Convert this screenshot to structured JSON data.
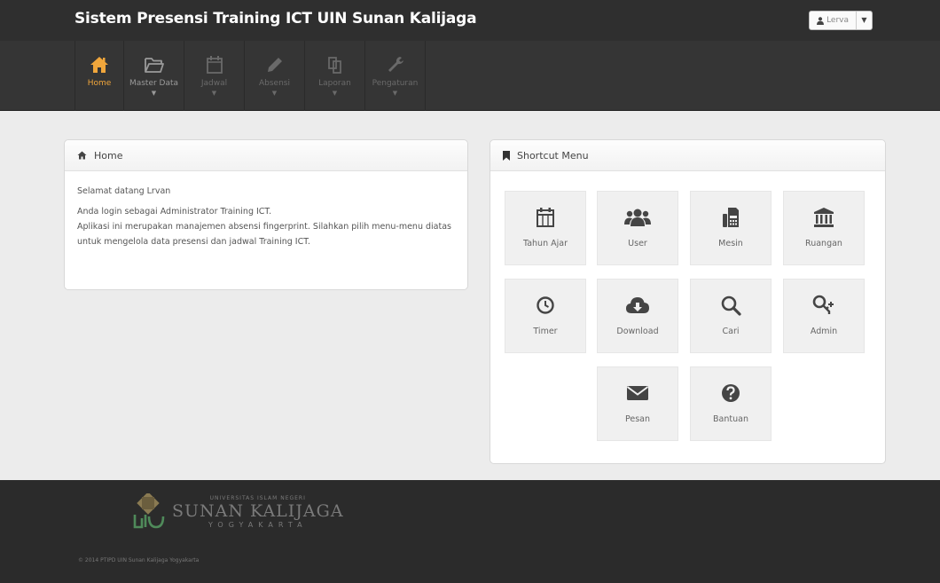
{
  "app": {
    "title": "Sistem Presensi Training ICT UIN Sunan Kalijaga"
  },
  "user_menu": {
    "label": "Lerva",
    "user_icon": "user-icon"
  },
  "nav": [
    {
      "label": "Home",
      "icon": "home-icon",
      "active": true
    },
    {
      "label": "Master Data",
      "icon": "folder-icon"
    },
    {
      "label": "Jadwal",
      "icon": "calendar-icon"
    },
    {
      "label": "Absensi",
      "icon": "pencil-icon"
    },
    {
      "label": "Laporan",
      "icon": "copy-icon"
    },
    {
      "label": "Pengaturan",
      "icon": "wrench-icon"
    }
  ],
  "home_panel": {
    "title": "Home",
    "greeting": "Selamat datang Lrvan",
    "line1": "Anda login sebagai Administrator Training ICT.",
    "line2": "Aplikasi ini merupakan manajemen absensi fingerprint. Silahkan pilih menu-menu diatas",
    "line3": "untuk mengelola data presensi dan jadwal Training ICT."
  },
  "shortcut_panel": {
    "title": "Shortcut Menu",
    "items": [
      {
        "label": "Tahun Ajar",
        "icon": "calendar-icon"
      },
      {
        "label": "User",
        "icon": "users-icon"
      },
      {
        "label": "Mesin",
        "icon": "fax-machine-icon"
      },
      {
        "label": "Ruangan",
        "icon": "building-icon"
      },
      {
        "label": "Timer",
        "icon": "clock-icon"
      },
      {
        "label": "Download",
        "icon": "cloud-download-icon"
      },
      {
        "label": "Cari",
        "icon": "search-icon"
      },
      {
        "label": "Admin",
        "icon": "key-icon"
      },
      {
        "label": "Pesan",
        "icon": "envelope-icon"
      },
      {
        "label": "Bantuan",
        "icon": "help-icon"
      }
    ]
  },
  "footer": {
    "uni_small": "UNIVERSITAS ISLAM NEGERI",
    "uni_big": "SUNAN KALIJAGA",
    "uni_city": "YOGYAKARTA",
    "copyright": "© 2014 PTIPD UIN Sunan Kalijaga Yogyakarta"
  },
  "colors": {
    "accent": "#f0a63c",
    "topbar": "#2f2f2f",
    "navbar": "#353535",
    "footer": "#2b2b2b",
    "tile": "#f0f0f0"
  }
}
